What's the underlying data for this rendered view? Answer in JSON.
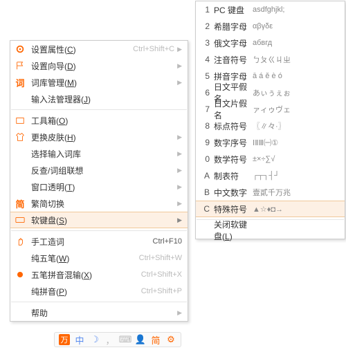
{
  "left_menu": {
    "items": [
      {
        "icon": "gear",
        "iconClass": "orange",
        "label": "设置属性",
        "key": "C",
        "shortcut": "Ctrl+Shift+C",
        "sub": true
      },
      {
        "icon": "flag",
        "iconClass": "orange",
        "label": "设置向导",
        "key": "D",
        "shortcut": "",
        "sub": true
      },
      {
        "icon": "词",
        "iconClass": "orange",
        "label": "词库管理",
        "key": "M",
        "shortcut": "",
        "sub": true
      },
      {
        "icon": "",
        "iconClass": "",
        "label": "输入法管理器",
        "key": "J",
        "shortcut": "",
        "sub": false
      },
      {
        "sep": true
      },
      {
        "icon": "box",
        "iconClass": "orange",
        "label": "工具箱",
        "key": "O",
        "shortcut": "",
        "sub": false
      },
      {
        "icon": "shirt",
        "iconClass": "orange",
        "label": "更换皮肤",
        "key": "H",
        "shortcut": "",
        "sub": true
      },
      {
        "icon": "",
        "iconClass": "",
        "label": "选择输入词库",
        "key": "",
        "shortcut": "",
        "sub": true
      },
      {
        "icon": "",
        "iconClass": "",
        "label": "反查/词组联想",
        "key": "",
        "shortcut": "",
        "sub": true
      },
      {
        "icon": "",
        "iconClass": "",
        "label": "窗口透明",
        "key": "T",
        "shortcut": "",
        "sub": true
      },
      {
        "icon": "简",
        "iconClass": "orange",
        "label": "繁简切换",
        "key": "",
        "shortcut": "",
        "sub": true
      },
      {
        "icon": "kbd",
        "iconClass": "orange",
        "label": "软键盘",
        "key": "S",
        "shortcut": "",
        "sub": true,
        "hover": true
      },
      {
        "sep": true
      },
      {
        "icon": "hand",
        "iconClass": "orange",
        "label": "手工造词",
        "key": "",
        "shortcut": "Ctrl+F10",
        "sub": false,
        "scDark": true
      },
      {
        "icon": "",
        "iconClass": "",
        "label": "纯五笔",
        "key": "W",
        "shortcut": "Ctrl+Shift+W",
        "sub": false
      },
      {
        "icon": "dot",
        "iconClass": "orange",
        "label": "五笔拼音混输",
        "key": "X",
        "shortcut": "Ctrl+Shift+X",
        "sub": false
      },
      {
        "icon": "",
        "iconClass": "",
        "label": "纯拼音",
        "key": "P",
        "shortcut": "Ctrl+Shift+P",
        "sub": false
      },
      {
        "sep": true
      },
      {
        "icon": "",
        "iconClass": "",
        "label": "帮助",
        "key": "",
        "shortcut": "",
        "sub": true
      }
    ]
  },
  "right_menu": {
    "items": [
      {
        "k": "1",
        "label": "PC 键盘",
        "sample": "asdfghjkl;"
      },
      {
        "k": "2",
        "label": "希腊字母",
        "sample": "αβγδε"
      },
      {
        "k": "3",
        "label": "俄文字母",
        "sample": "абвгд"
      },
      {
        "k": "4",
        "label": "注音符号",
        "sample": "ㄅㄆㄍㄐㄓ"
      },
      {
        "k": "5",
        "label": "拼音字母",
        "sample": "ā á ě è ó"
      },
      {
        "k": "6",
        "label": "日文平假名",
        "sample": "あぃぅぇぉ"
      },
      {
        "k": "7",
        "label": "日文片假名",
        "sample": "ァィゥヴェ"
      },
      {
        "k": "8",
        "label": "标点符号",
        "sample": "〖∥々·〗"
      },
      {
        "k": "9",
        "label": "数字序号",
        "sample": "ⅠⅡⅢ㈠①"
      },
      {
        "k": "0",
        "label": "数学符号",
        "sample": "±×÷∑√"
      },
      {
        "k": "A",
        "label": "制表符",
        "sample": "┌┬┐┤┘"
      },
      {
        "k": "B",
        "label": "中文数字",
        "sample": "壹貳千万兆"
      },
      {
        "k": "C",
        "label": "特殊符号",
        "sample": "▲☆♦◘→",
        "hover": true
      },
      {
        "sep": true
      },
      {
        "k": "",
        "label": "关闭软键盘",
        "key": "L",
        "sample": ""
      }
    ]
  },
  "taskbar": {
    "items": [
      {
        "t": "万",
        "c": "orange",
        "bg": true
      },
      {
        "t": "中",
        "c": "blue"
      },
      {
        "t": "☽",
        "c": "blue"
      },
      {
        "t": "，",
        "c": "gray"
      },
      {
        "t": "⌨",
        "c": "gray"
      },
      {
        "t": "👤",
        "c": "gray"
      },
      {
        "t": "简",
        "c": "orange"
      },
      {
        "t": "⚙",
        "c": "orange"
      }
    ]
  }
}
